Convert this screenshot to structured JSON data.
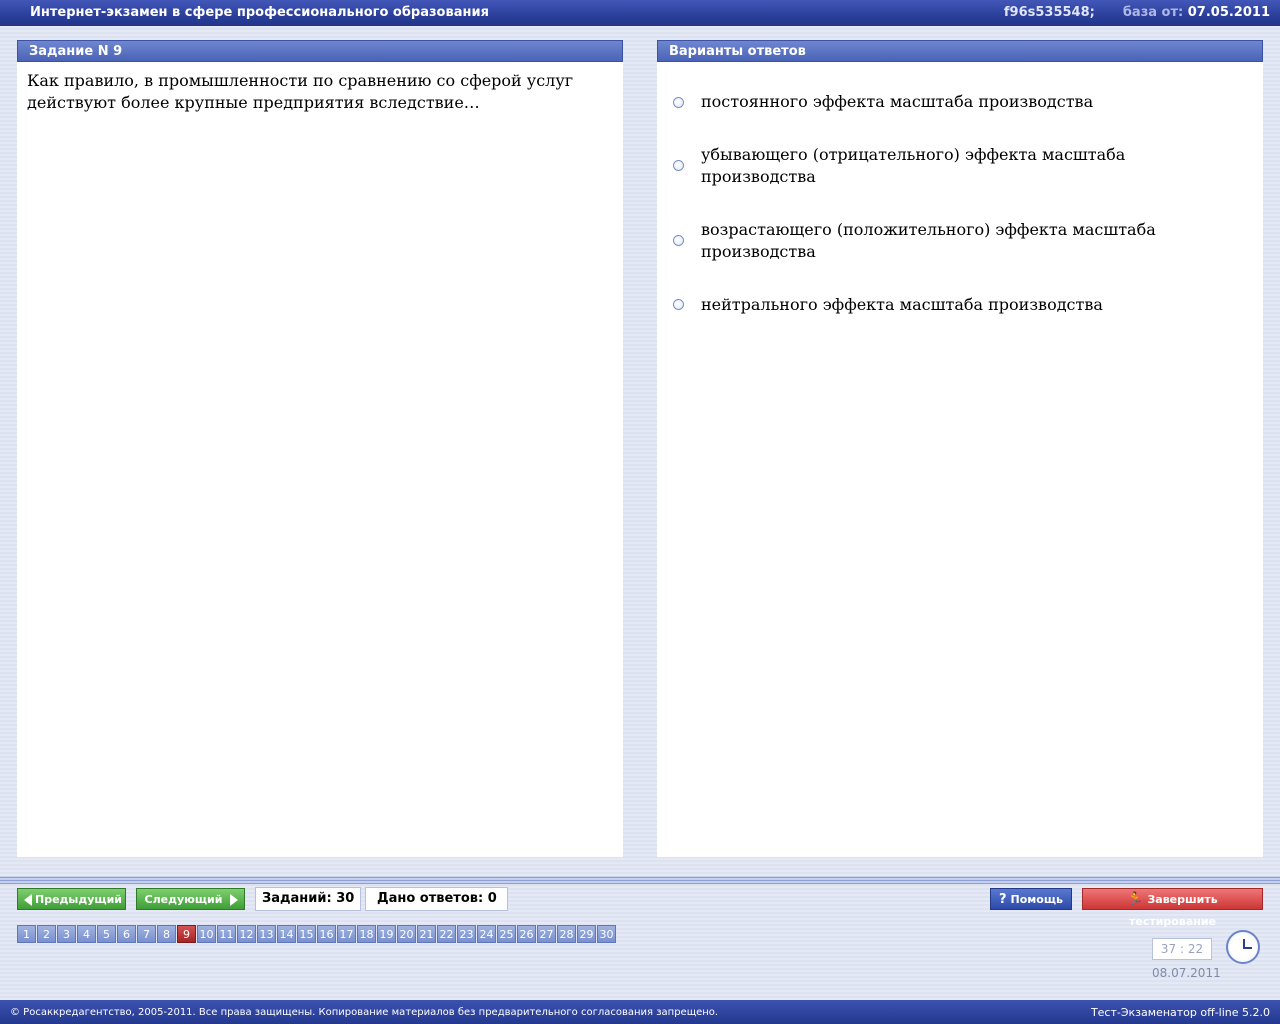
{
  "window": {
    "title": "Интернет-экзамен в сфере профессионального образования",
    "session_id": "f96s535548;",
    "base_label": "база от:",
    "base_date": "07.05.2011"
  },
  "task": {
    "header": "Задание N 9",
    "question": "Как правило, в промышленности по сравнению со сферой услуг действуют более крупные предприятия вследствие…"
  },
  "answers": {
    "header": "Варианты ответов",
    "options": [
      "постоянного эффекта масштаба производства",
      "убывающего (отрицательного) эффекта масштаба производства",
      "возрастающего (положительного) эффекта масштаба производства",
      "нейтрального эффекта масштаба производства"
    ]
  },
  "nav": {
    "prev_label": "Предыдущий",
    "next_label": "Следующий",
    "tasks_count": "Заданий: 30",
    "answers_given": "Дано ответов: 0",
    "help_label": "Помощь",
    "finish_label": "Завершить тестирование",
    "current_page": 9,
    "pages": [
      "1",
      "2",
      "3",
      "4",
      "5",
      "6",
      "7",
      "8",
      "9",
      "10",
      "11",
      "12",
      "13",
      "14",
      "15",
      "16",
      "17",
      "18",
      "19",
      "20",
      "21",
      "22",
      "23",
      "24",
      "25",
      "26",
      "27",
      "28",
      "29",
      "30"
    ]
  },
  "timer": {
    "value": "37 : 22",
    "date": "08.07.2011"
  },
  "footer": {
    "copyright": "© Росаккредагентство, 2005-2011. Все права защищены. Копирование материалов без предварительного согласования запрещено.",
    "version": "Тест-Экзаменатор off-line 5.2.0"
  },
  "colors": {
    "accent": "#2b3f9a",
    "current_page": "#b22c2c",
    "next_green": "#3e9e36",
    "finish_red": "#cc3636"
  }
}
